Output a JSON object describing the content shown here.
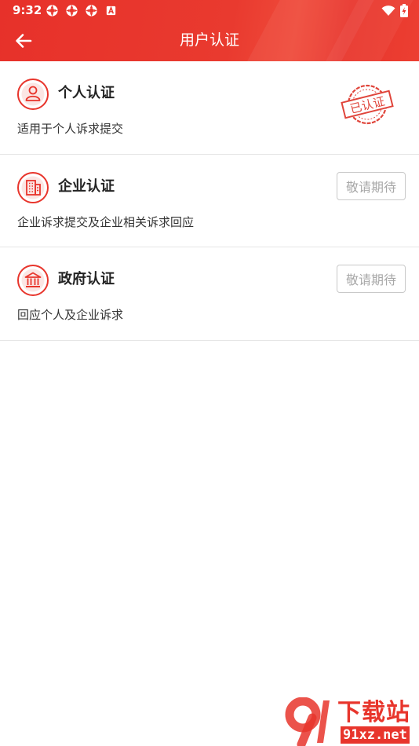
{
  "status_bar": {
    "time": "9:32",
    "notification_icons": [
      "sync-icon",
      "sync-icon",
      "sync-icon",
      "text-a-icon"
    ],
    "right_icons": [
      "wifi-icon",
      "battery-charging-icon"
    ]
  },
  "header": {
    "title": "用户认证",
    "back_icon": "arrow-left-icon",
    "background_color": "#e8352c"
  },
  "cards": [
    {
      "title": "个人认证",
      "description": "适用于个人诉求提交",
      "icon": "person-icon",
      "status_stamp": "已认证"
    },
    {
      "title": "企业认证",
      "description": "企业诉求提交及企业相关诉求回应",
      "icon": "building-icon",
      "action_label": "敬请期待"
    },
    {
      "title": "政府认证",
      "description": "回应个人及企业诉求",
      "icon": "government-icon",
      "action_label": "敬请期待"
    }
  ],
  "watermark": {
    "text": "下载站",
    "domain": "91xz.net"
  },
  "colors": {
    "accent": "#e8352c",
    "disabled_text": "#a8a8a8",
    "divider": "#e5e5e5"
  }
}
